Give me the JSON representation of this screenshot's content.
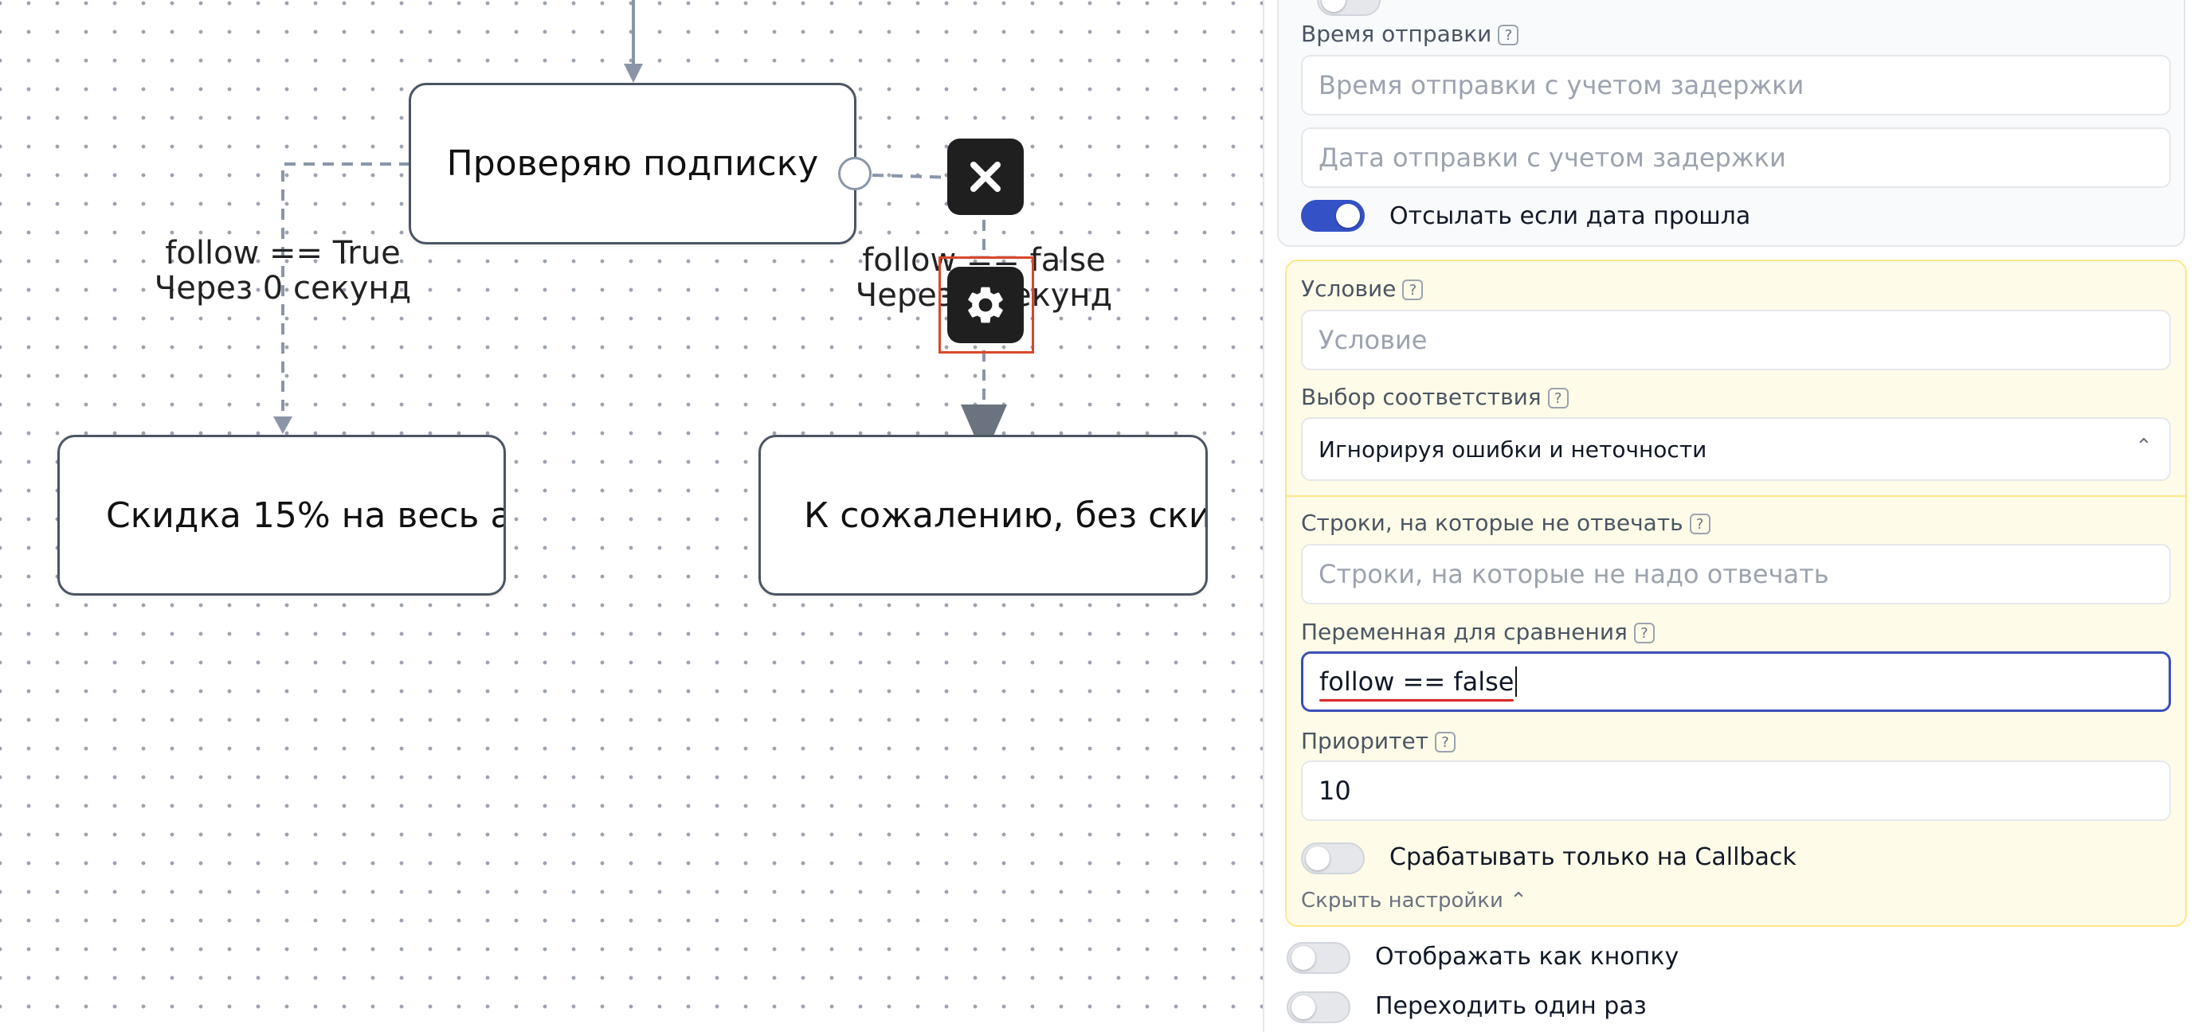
{
  "canvas": {
    "nodes": {
      "check_subscription": "Проверяю подписку",
      "discount": "Скидка 15% на весь а",
      "no_discount": "К сожалению, без ски"
    },
    "edges": {
      "true_edge": {
        "condition": "follow == True",
        "delay": "Через 0 секунд"
      },
      "false_edge": {
        "condition": "follow == false",
        "delay": "Через 0 секунд"
      }
    },
    "buttons": {
      "delete_icon": "close-icon",
      "settings_icon": "gear-icon"
    }
  },
  "panel": {
    "send_time": {
      "label": "Время отправки",
      "help": "?",
      "time_placeholder": "Время отправки с учетом задержки",
      "date_placeholder": "Дата отправки с учетом задержки",
      "send_if_past_label": "Отсылать если дата прошла",
      "send_if_past_on": true
    },
    "condition": {
      "label": "Условие",
      "help": "?",
      "placeholder": "Условие"
    },
    "match": {
      "label": "Выбор соответствия",
      "help": "?",
      "value": "Игнорируя ошибки и неточности"
    },
    "ignore_lines": {
      "label": "Строки, на которые не отвечать",
      "help": "?",
      "placeholder": "Строки, на которые не надо отвечать"
    },
    "compare_var": {
      "label": "Переменная для сравнения",
      "help": "?",
      "value": "follow == false"
    },
    "priority": {
      "label": "Приоритет",
      "help": "?",
      "value": "10"
    },
    "callback_only": {
      "label": "Срабатывать только на Callback",
      "on": false
    },
    "hide_settings": "Скрыть настройки",
    "show_as_button": {
      "label": "Отображать как кнопку",
      "on": false
    },
    "go_once": {
      "label": "Переходить один раз",
      "on": false
    }
  },
  "colors": {
    "accent": "#3451c6",
    "edge": "#8a96a8",
    "highlight": "#d9472b",
    "panel_yellow": "#fefce8"
  }
}
